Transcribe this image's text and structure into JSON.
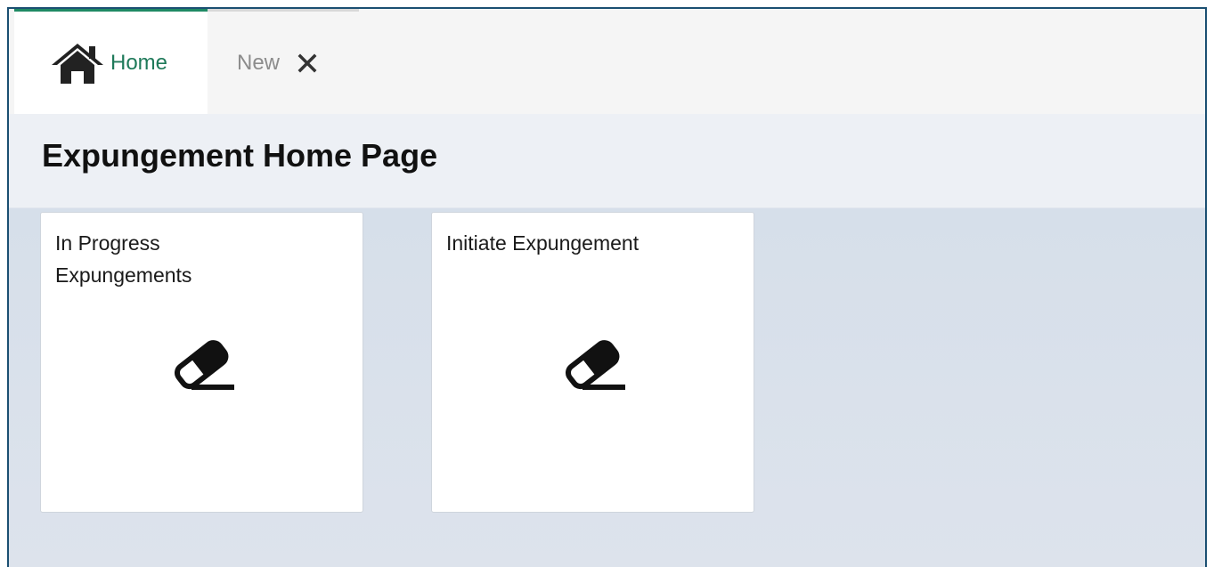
{
  "tabs": [
    {
      "label": "Home",
      "icon": "home-icon",
      "active": true
    },
    {
      "label": "New",
      "icon": "close-icon",
      "active": false
    }
  ],
  "page": {
    "title": "Expungement Home Page"
  },
  "cards": [
    {
      "title": "In Progress Expungements",
      "icon": "eraser-icon"
    },
    {
      "title": "Initiate Expungement",
      "icon": "eraser-icon"
    }
  ],
  "colors": {
    "accent": "#1f8a64",
    "frame_border": "#1b4f72",
    "content_bg": "#dde3ec",
    "header_bg": "#edf0f5"
  }
}
